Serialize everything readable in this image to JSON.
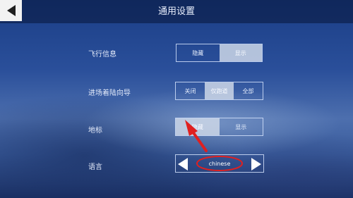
{
  "header": {
    "title": "通用设置",
    "back_icon": "back-arrow-icon"
  },
  "settings": {
    "flight_info": {
      "label": "飞行信息",
      "options": [
        "隐藏",
        "显示"
      ],
      "selected": "显示"
    },
    "approach_guide": {
      "label": "进场着陆向导",
      "options": [
        "关闭",
        "仅跑道",
        "全部"
      ],
      "selected": "仅跑道"
    },
    "landmark": {
      "label": "地标",
      "options": [
        "隐藏",
        "显示"
      ],
      "selected": "隐藏"
    },
    "language": {
      "label": "语言",
      "value": "chinese",
      "prev_icon": "triangle-left-icon",
      "next_icon": "triangle-right-icon"
    }
  },
  "annotation": {
    "arrow_color": "#e02020",
    "circle_color": "#e02020"
  },
  "colors": {
    "sky_top": "#1b3e86",
    "sky_mid": "#4d6fae",
    "option_active": "#cdd7e8"
  }
}
